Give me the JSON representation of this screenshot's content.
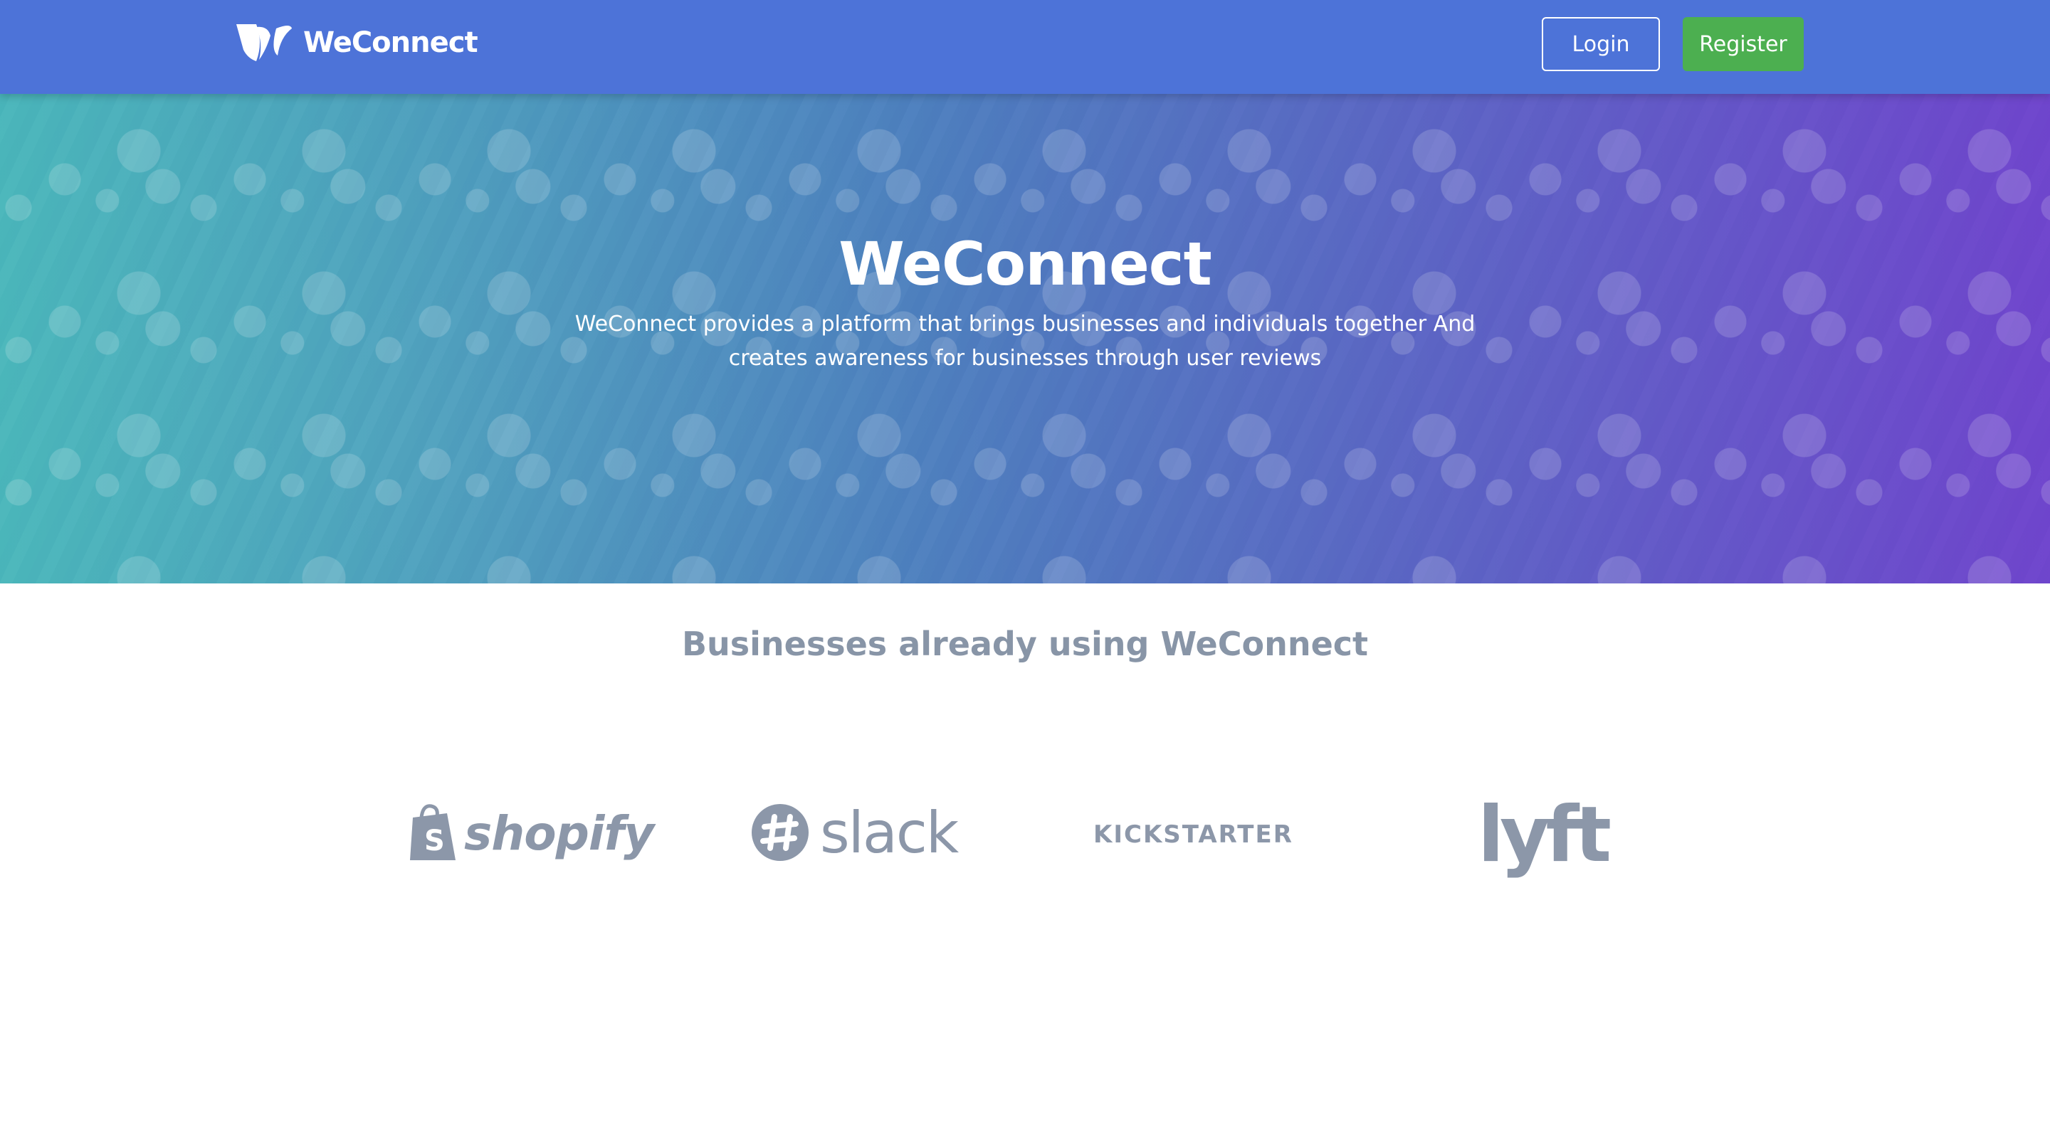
{
  "navbar": {
    "brand": "WeConnect",
    "login_label": "Login",
    "register_label": "Register"
  },
  "hero": {
    "title": "WeConnect",
    "subtitle": "WeConnect provides a platform that brings businesses and individuals together And creates awareness for businesses through user reviews"
  },
  "businesses": {
    "title": "Businesses already using WeConnect",
    "logos": [
      {
        "name": "shopify",
        "text": "shopify"
      },
      {
        "name": "slack",
        "text": "slack"
      },
      {
        "name": "kickstarter",
        "text": "KICKSTARTER"
      },
      {
        "name": "lyft",
        "text": "lyft"
      }
    ]
  },
  "colors": {
    "navbar": "#4d73d8",
    "register": "#4caf50",
    "logo_gray": "#8c97a9",
    "section_title": "#8895a7"
  }
}
